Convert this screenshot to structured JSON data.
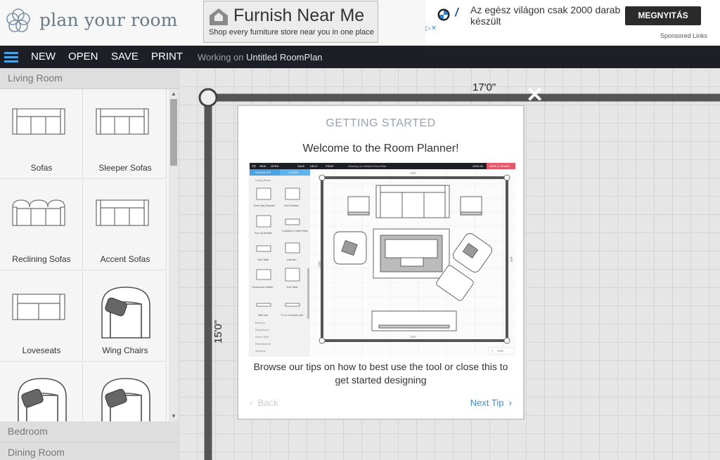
{
  "site": {
    "name": "plan your room"
  },
  "ads": {
    "furnish": {
      "title": "Furnish Near Me",
      "subtitle": "Shop every furniture store near you in one place"
    },
    "bmw": {
      "text": "Az egész világon csak 2000 darab készült",
      "button": "MEGNYITÁS",
      "sponsored": "Sponsored Links"
    }
  },
  "toolbar": {
    "items": [
      "NEW",
      "OPEN",
      "SAVE",
      "PRINT"
    ],
    "working_prefix": "Working on",
    "document": "Untitled RoomPlan"
  },
  "sidebar": {
    "open_category": "Living Room",
    "items": [
      {
        "label": "Sofas"
      },
      {
        "label": "Sleeper Sofas"
      },
      {
        "label": "Reclining Sofas"
      },
      {
        "label": "Accent Sofas"
      },
      {
        "label": "Loveseats"
      },
      {
        "label": "Wing Chairs"
      },
      {
        "label": ""
      },
      {
        "label": ""
      }
    ],
    "collapsed_categories": [
      "Bedroom",
      "Dining Room"
    ]
  },
  "canvas": {
    "width_label": "17'0\"",
    "height_label": "15'0\""
  },
  "modal": {
    "kicker": "GETTING STARTED",
    "title": "Welcome to the Room Planner!",
    "description": "Browse our tips on how to best use the tool or close this to get started designing",
    "back": "Back",
    "next": "Next Tip",
    "preview": {
      "menu": [
        "NEW",
        "OPEN",
        "SAVE",
        "HELP",
        "PRINT"
      ],
      "working": "Working on Untitled RoomPlan",
      "sign_in": "SIGN IN",
      "save_share": "SAVE & SHARE",
      "tabs": [
        "FAVORITES",
        "ICONS"
      ],
      "category": "Living Room",
      "items": [
        "Three Way Recliner",
        "Club Recliner",
        "Pop Up Recliner",
        "Cocktail or Coffee Table",
        "Sofa Table",
        "Ottoman",
        "Occasional Cabinet",
        "End Table",
        "Wall Unit",
        "TV or Computer Unit"
      ],
      "other_categories": [
        "Bedroom",
        "Dining Room",
        "Home Office",
        "Miscellaneous",
        "Structural"
      ],
      "dim_top": "17'0\"",
      "dim_bottom": "17'0\"",
      "dim_side": "15'0\"",
      "zoom": "100%"
    }
  },
  "icons": {
    "close": "close-icon",
    "logo": "flower-logo-icon",
    "menu": "hamburger-icon"
  }
}
